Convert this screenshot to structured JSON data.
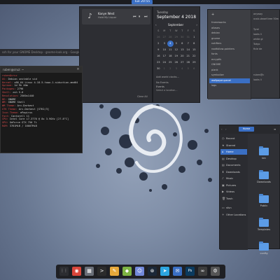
{
  "topbar": {
    "clock": "Tue 20:55"
  },
  "browser_strip": {
    "title": "ssh for your GNOME Desktop - gnome-look.org - Google Chrome"
  },
  "notifications": {
    "media": {
      "title": "Kanye West",
      "subtitle": "Hold My Liquor",
      "prev": "⏮",
      "play": "⏸",
      "next": "⏭"
    },
    "clear": "Clear All"
  },
  "calendar": {
    "day": "Tuesday",
    "date": "September 4 2018",
    "month": "September",
    "prev": "‹",
    "next": "›",
    "headers": [
      "S",
      "M",
      "T",
      "W",
      "T",
      "F",
      "S"
    ],
    "weeks": [
      [
        "26",
        "27",
        "28",
        "29",
        "30",
        "31",
        "1"
      ],
      [
        "2",
        "3",
        "4",
        "5",
        "6",
        "7",
        "8"
      ],
      [
        "9",
        "10",
        "11",
        "12",
        "13",
        "14",
        "15"
      ],
      [
        "16",
        "17",
        "18",
        "19",
        "20",
        "21",
        "22"
      ],
      [
        "23",
        "24",
        "25",
        "26",
        "27",
        "28",
        "29"
      ],
      [
        "30",
        "1",
        "2",
        "3",
        "4",
        "5",
        "6"
      ]
    ],
    "today": "4",
    "world_clocks": "Add world clocks...",
    "schedule_hint": "No Events",
    "events_label": "Events",
    "events_sub": "Select a location..."
  },
  "terminal": {
    "title": "ruben@cruz: ~",
    "close": "×",
    "lines": [
      {
        "k": "ruben@cruz",
        "v": ""
      },
      {
        "k": "OS:",
        "v": " Debian unstable sid"
      },
      {
        "k": "Kernel:",
        "v": " x86_64 Linux 4.18.5-towo.1-siduction-amd64"
      },
      {
        "k": "Uptime:",
        "v": " 1d 9h 40m"
      },
      {
        "k": "Packages:",
        "v": " 2796"
      },
      {
        "k": "Shell:",
        "v": " zsh 5.6"
      },
      {
        "k": "Resolution:",
        "v": " 2560x1440"
      },
      {
        "k": "DE:",
        "v": " GNOME"
      },
      {
        "k": "WM:",
        "v": " GNOME Shell"
      },
      {
        "k": "WM Theme:",
        "v": " Arc-Darkest"
      },
      {
        "k": "GTK Theme:",
        "v": " Arc-Darkest [GTK2/3]"
      },
      {
        "k": "Icon Theme:",
        "v": " ePapirus"
      },
      {
        "k": "Font:",
        "v": " Cantarell 11"
      },
      {
        "k": "CPU:",
        "v": " Intel Core i7-3770 @ 8x 3.9GHz [27.8°C]"
      },
      {
        "k": "GPU:",
        "v": " GeForce GTX 750 Ti"
      },
      {
        "k": "RAM:",
        "v": " 3761MiB / 16007MiB"
      }
    ]
  },
  "settings": {
    "plus": "+",
    "items": [
      "frameworks",
      "aliases",
      "debian",
      "gnome",
      "notifiers",
      "rootfollow-pointers",
      "fonts",
      "ecryptfs",
      "GNOME",
      "plank",
      "symbolize",
      "wallpaper-panel",
      "logs"
    ],
    "selected": 11,
    "right": [
      "anyway",
      "xcalc-dwarf-tree 50m",
      "Tyrel",
      "looks li",
      "white gl",
      "Tokyo",
      "ficle de",
      "ruben@c",
      "looks li"
    ]
  },
  "files": {
    "back": "‹",
    "fwd": "›",
    "path": "Home",
    "menu": "≡",
    "sidebar": [
      {
        "icon": "◷",
        "label": "Recent"
      },
      {
        "icon": "★",
        "label": "Starred"
      },
      {
        "icon": "⌂",
        "label": "Home"
      },
      {
        "icon": "▤",
        "label": "Desktop"
      },
      {
        "icon": "▤",
        "label": "Documents"
      },
      {
        "icon": "⬇",
        "label": "Downloads"
      },
      {
        "icon": "♪",
        "label": "Music"
      },
      {
        "icon": "▣",
        "label": "Pictures"
      },
      {
        "icon": "▶",
        "label": "Videos"
      },
      {
        "icon": "🗑",
        "label": "Trash"
      },
      {
        "icon": "▭",
        "label": "sfun"
      },
      {
        "icon": "+",
        "label": "Other Locations"
      }
    ],
    "selected": 2,
    "folders": [
      "bin",
      "Downloads",
      "Public",
      "Templates",
      "config"
    ]
  },
  "dock": {
    "icons": [
      {
        "name": "apps-grid-icon",
        "glyph": "⋮⋮",
        "color": "#2c2d31"
      },
      {
        "name": "chrome-icon",
        "glyph": "◉",
        "color": "#d9453a"
      },
      {
        "name": "files-icon",
        "glyph": "▦",
        "color": "#6a6f78"
      },
      {
        "name": "terminal-icon",
        "glyph": ">",
        "color": "#2b2b2b"
      },
      {
        "name": "editor-icon",
        "glyph": "✎",
        "color": "#e6a83a"
      },
      {
        "name": "android-icon",
        "glyph": "◆",
        "color": "#7cb342"
      },
      {
        "name": "discord-icon",
        "glyph": "☺",
        "color": "#7289da"
      },
      {
        "name": "steam-icon",
        "glyph": "⊛",
        "color": "#1b2838"
      },
      {
        "name": "telegram-icon",
        "glyph": "➤",
        "color": "#2ca5e0"
      },
      {
        "name": "mail-icon",
        "glyph": "✉",
        "color": "#3a6fc4"
      },
      {
        "name": "photoshop-icon",
        "glyph": "Ps",
        "color": "#0b3a5e"
      },
      {
        "name": "extension-icon",
        "glyph": "∞",
        "color": "#3c3c3c"
      },
      {
        "name": "settings-icon",
        "glyph": "⚙",
        "color": "#555"
      }
    ]
  }
}
